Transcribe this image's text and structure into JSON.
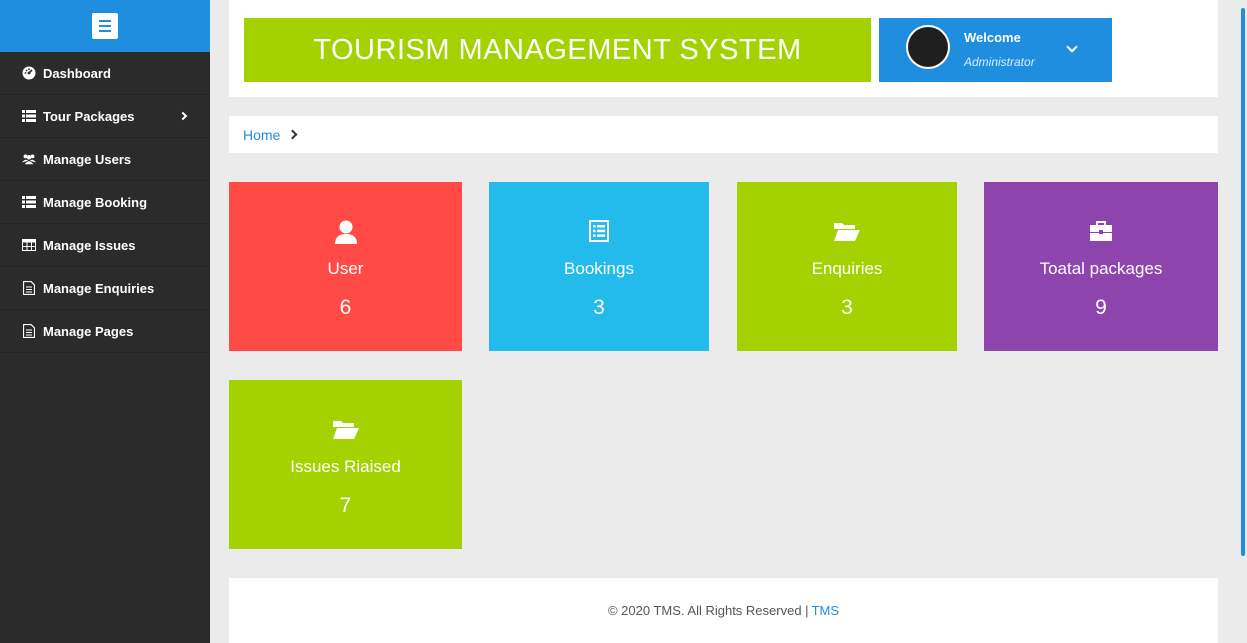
{
  "sidebar": {
    "items": [
      {
        "label": "Dashboard",
        "icon": "dashboard-icon"
      },
      {
        "label": "Tour Packages",
        "icon": "list-icon"
      },
      {
        "label": "Manage Users",
        "icon": "users-icon"
      },
      {
        "label": "Manage Booking",
        "icon": "list-icon"
      },
      {
        "label": "Manage Issues",
        "icon": "table-icon"
      },
      {
        "label": "Manage Enquiries",
        "icon": "file-icon"
      },
      {
        "label": "Manage Pages",
        "icon": "file-icon"
      }
    ]
  },
  "header": {
    "title": "TOURISM MANAGEMENT SYSTEM",
    "welcome": "Welcome",
    "role": "Administrator"
  },
  "breadcrumb": {
    "home": "Home"
  },
  "tiles": [
    {
      "label": "User",
      "value": "6",
      "icon": "user-icon",
      "color": "#ff4a45"
    },
    {
      "label": "Bookings",
      "value": "3",
      "icon": "list-alt-icon",
      "color": "#22bbeb"
    },
    {
      "label": "Enquiries",
      "value": "3",
      "icon": "folder-open-icon",
      "color": "#a3d200"
    },
    {
      "label": "Toatal packages",
      "value": "9",
      "icon": "briefcase-icon",
      "color": "#8e44ad"
    },
    {
      "label": "Issues Riaised",
      "value": "7",
      "icon": "folder-open-icon",
      "color": "#a3d200"
    }
  ],
  "footer": {
    "text": "© 2020 TMS. All Rights Reserved |",
    "link": "TMS"
  },
  "colors": {
    "primary": "#1f8ede",
    "sidebar": "#2b2b2b",
    "title_bg": "#a3d200"
  }
}
